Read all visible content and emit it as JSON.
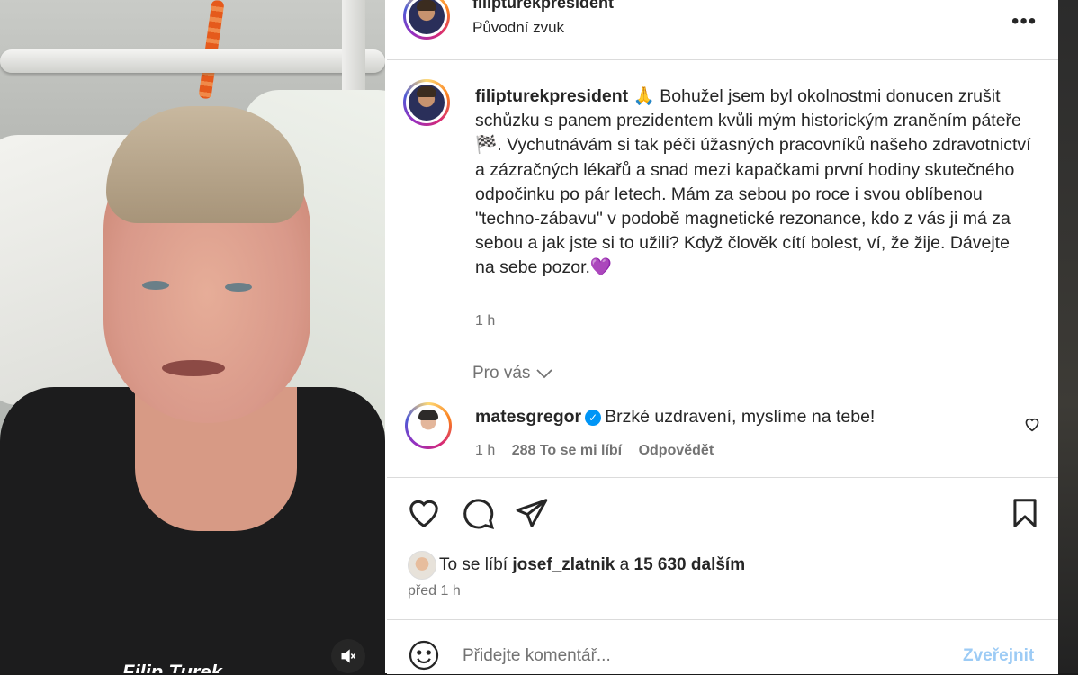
{
  "video": {
    "caption_partial": "Filip Turek",
    "mute_icon": "speaker-muted-icon"
  },
  "header": {
    "username": "filipturekpresident",
    "audio": "Původní zvuk",
    "more_icon": "more-horizontal-icon"
  },
  "post_caption": {
    "username": "filipturekpresident",
    "text": "🙏 Bohužel jsem byl okolnostmi donucen zrušit schůzku s panem prezidentem kvůli mým historickým zraněním páteře🏁. Vychutnávám si tak péči úžasných pracovníků našeho zdravotnictví a zázračných lékařů a snad mezi kapačkami první hodiny skutečného odpočinku po pár letech. Mám za sebou po roce i svou oblíbenou \"techno-zábavu\" v podobě magnetické rezonance, kdo z vás ji má za sebou a jak jste si to užili? Když člověk cítí bolest, ví, že žije. Dávejte na sebe pozor.💜",
    "time": "1 h"
  },
  "pro_vas": "Pro vás",
  "comment": {
    "username": "matesgregor",
    "text": "Brzké uzdravení, myslíme na tebe!",
    "time": "1 h",
    "likes": "288 To se mi líbí",
    "reply": "Odpovědět"
  },
  "actions": {
    "like_icon": "heart-icon",
    "comment_icon": "comment-icon",
    "share_icon": "send-icon",
    "save_icon": "bookmark-icon"
  },
  "likes_line": {
    "prefix": "To se líbí",
    "user": "josef_zlatnik",
    "and": "a",
    "others": "15 630 dalším"
  },
  "posted": "před 1 h",
  "comment_box": {
    "placeholder": "Přidejte komentář...",
    "publish": "Zveřejnit"
  }
}
